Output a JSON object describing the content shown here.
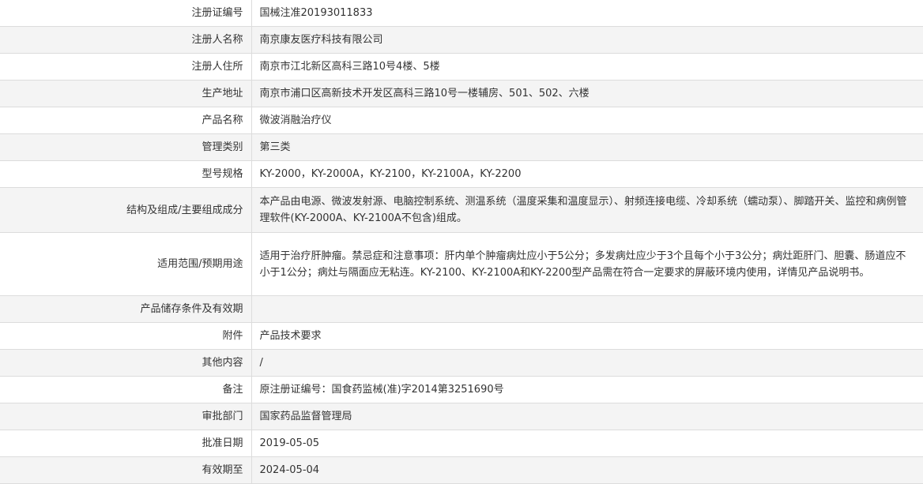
{
  "rows": [
    {
      "label": "注册证编号",
      "value": "国械注准20193011833"
    },
    {
      "label": "注册人名称",
      "value": "南京康友医疗科技有限公司"
    },
    {
      "label": "注册人住所",
      "value": "南京市江北新区高科三路10号4楼、5楼"
    },
    {
      "label": "生产地址",
      "value": "南京市浦口区高新技术开发区高科三路10号一楼辅房、501、502、六楼"
    },
    {
      "label": "产品名称",
      "value": "微波消融治疗仪"
    },
    {
      "label": "管理类别",
      "value": "第三类"
    },
    {
      "label": "型号规格",
      "value": "KY-2000，KY-2000A，KY-2100，KY-2100A，KY-2200"
    },
    {
      "label": "结构及组成/主要组成成分",
      "value": "本产品由电源、微波发射源、电脑控制系统、测温系统（温度采集和温度显示）、射频连接电缆、冷却系统（蠕动泵）、脚踏开关、监控和病例管理软件(KY-2000A、KY-2100A不包含)组成。"
    },
    {
      "label": "适用范围/预期用途",
      "value": "适用于治疗肝肿瘤。禁忌症和注意事项：肝内单个肿瘤病灶应小于5公分；多发病灶应少于3个且每个小于3公分；病灶距肝门、胆囊、肠道应不小于1公分；病灶与隔面应无粘连。KY-2100、KY-2100A和KY-2200型产品需在符合一定要求的屏蔽环境内使用，详情见产品说明书。"
    },
    {
      "label": "产品储存条件及有效期",
      "value": ""
    },
    {
      "label": "附件",
      "value": "产品技术要求"
    },
    {
      "label": "其他内容",
      "value": "/"
    },
    {
      "label": "备注",
      "value": "原注册证编号：国食药监械(准)字2014第3251690号"
    },
    {
      "label": "审批部门",
      "value": "国家药品监督管理局"
    },
    {
      "label": "批准日期",
      "value": "2019-05-05"
    },
    {
      "label": "有效期至",
      "value": "2024-05-04"
    }
  ]
}
